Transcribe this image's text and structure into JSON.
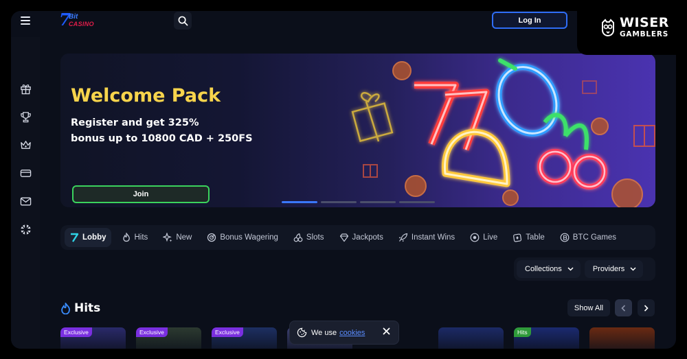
{
  "header": {
    "menu_icon": "hamburger-icon",
    "logo": {
      "seven": "7",
      "bit": "Bit",
      "casino": "CASINO"
    },
    "search_icon": "search-icon",
    "login_label": "Log In"
  },
  "badge": {
    "line1": "WISER",
    "line2": "GAMBLERS"
  },
  "sidebar": {
    "items": [
      {
        "icon": "gift-icon"
      },
      {
        "icon": "trophy-icon"
      },
      {
        "icon": "crown-icon"
      },
      {
        "icon": "card-icon"
      },
      {
        "icon": "mail-icon"
      },
      {
        "icon": "uk-flag-icon"
      }
    ]
  },
  "banner": {
    "title": "Welcome Pack",
    "subtitle_line1": "Register and get 325%",
    "subtitle_line2": "bonus up to 10800 CAD + 250FS",
    "join_label": "Join",
    "slide_count": 4,
    "active_slide": 1
  },
  "categories": [
    {
      "label": "Lobby",
      "icon": "7bit-icon",
      "active": true
    },
    {
      "label": "Hits",
      "icon": "flame-icon"
    },
    {
      "label": "New",
      "icon": "sparkle-icon"
    },
    {
      "label": "Bonus Wagering",
      "icon": "wagering-icon"
    },
    {
      "label": "Slots",
      "icon": "cherry-icon"
    },
    {
      "label": "Jackpots",
      "icon": "diamond-icon"
    },
    {
      "label": "Instant Wins",
      "icon": "rocket-icon"
    },
    {
      "label": "Live",
      "icon": "live-icon"
    },
    {
      "label": "Table",
      "icon": "chip-icon"
    },
    {
      "label": "BTC Games",
      "icon": "bitcoin-icon"
    }
  ],
  "filters": {
    "collections_label": "Collections",
    "providers_label": "Providers"
  },
  "hits_section": {
    "title": "Hits",
    "show_all_label": "Show All"
  },
  "games": [
    {
      "tag": "Exclusive",
      "tag_type": "exclusive",
      "color": "#2a2a6a"
    },
    {
      "tag": "Exclusive",
      "tag_type": "exclusive",
      "color": "#2c3a30"
    },
    {
      "tag": "Exclusive",
      "tag_type": "exclusive",
      "color": "#1d2f62"
    },
    {
      "tag": "",
      "tag_type": "",
      "color": "#3b3f70"
    },
    {
      "tag": "",
      "tag_type": "",
      "color": "#1c2a66"
    },
    {
      "tag": "Hits",
      "tag_type": "hits",
      "color": "#1b2a70"
    },
    {
      "tag": "",
      "tag_type": "",
      "color": "#6a2a12"
    }
  ],
  "cookie": {
    "text": "We use",
    "link": "cookies"
  },
  "colors": {
    "accent_blue": "#2f6df6",
    "accent_green": "#3bd35d",
    "title_yellow": "#f7d44c",
    "exclusive_purple": "#7a2fe0"
  }
}
